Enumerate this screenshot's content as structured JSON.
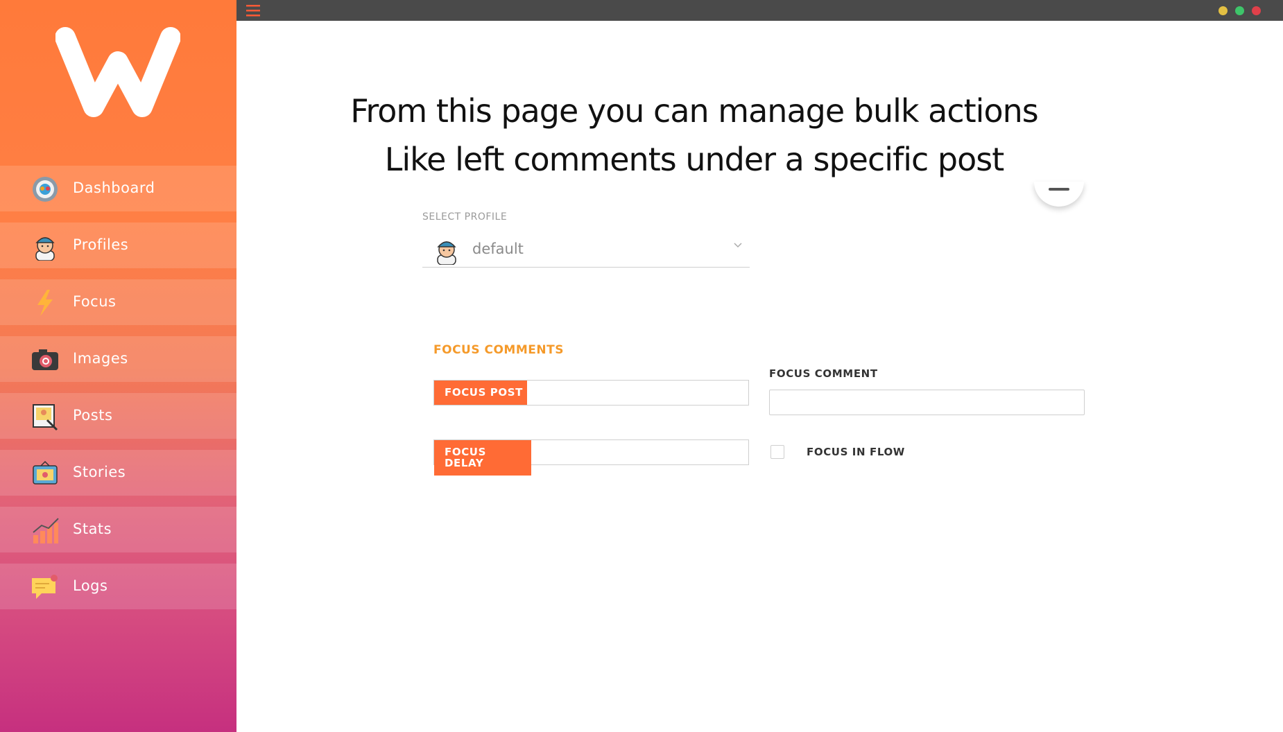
{
  "logo": {
    "letter": "W",
    "icon": "w-logo-icon"
  },
  "sidebar": {
    "items": [
      {
        "label": "Dashboard",
        "icon": "gear-icon"
      },
      {
        "label": "Profiles",
        "icon": "avatar-icon"
      },
      {
        "label": "Focus",
        "icon": "lightning-icon"
      },
      {
        "label": "Images",
        "icon": "camera-icon"
      },
      {
        "label": "Posts",
        "icon": "picture-frame-icon"
      },
      {
        "label": "Stories",
        "icon": "stories-icon"
      },
      {
        "label": "Stats",
        "icon": "bar-chart-icon"
      },
      {
        "label": "Logs",
        "icon": "chat-bubble-icon"
      }
    ]
  },
  "topbar": {
    "dots": [
      "#e3c043",
      "#3ec56a",
      "#e0404a"
    ]
  },
  "main": {
    "headline_line1": "From this page you can manage bulk actions",
    "headline_line2": "Like left comments under a specific post",
    "select_label": "SELECT PROFILE",
    "select_value": "default",
    "section_title": "FOCUS COMMENTS",
    "focus_post_tag": "FOCUS POST",
    "focus_post_value": "",
    "focus_delay_tag_line1": "FOCUS",
    "focus_delay_tag_line2": "DELAY",
    "focus_delay_value": "",
    "focus_comment_label": "FOCUS COMMENT",
    "focus_comment_value": "",
    "focus_in_flow_label": "FOCUS IN FLOW",
    "focus_in_flow_checked": false
  },
  "colors": {
    "accent": "#ff6b35",
    "section_title": "#f59a2a",
    "topbar": "#4a4a4a"
  }
}
